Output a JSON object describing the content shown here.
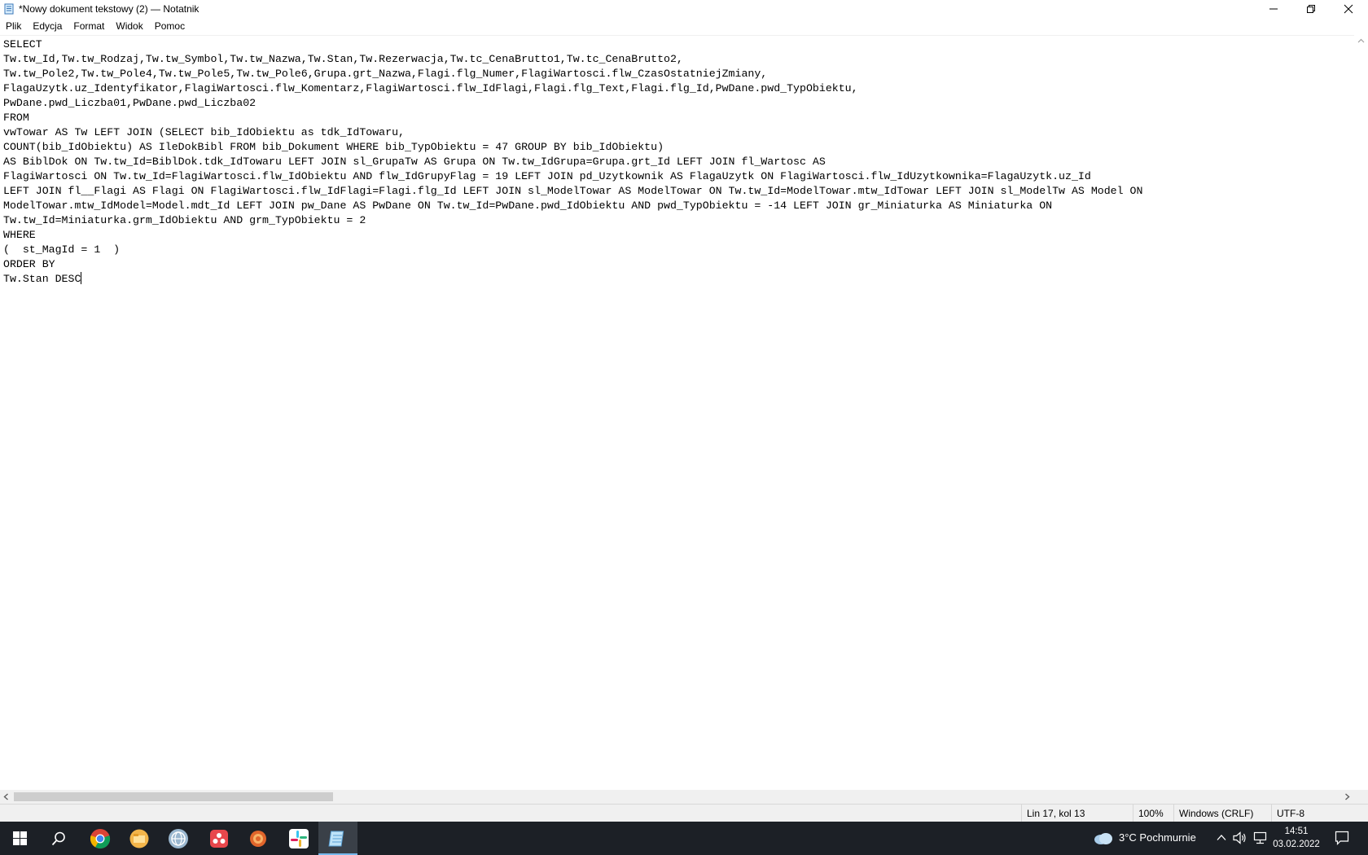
{
  "window": {
    "title": "*Nowy dokument tekstowy (2) — Notatnik"
  },
  "menu": {
    "items": [
      "Plik",
      "Edycja",
      "Format",
      "Widok",
      "Pomoc"
    ]
  },
  "editor": {
    "lines": [
      "SELECT",
      "Tw.tw_Id,Tw.tw_Rodzaj,Tw.tw_Symbol,Tw.tw_Nazwa,Tw.Stan,Tw.Rezerwacja,Tw.tc_CenaBrutto1,Tw.tc_CenaBrutto2,",
      "Tw.tw_Pole2,Tw.tw_Pole4,Tw.tw_Pole5,Tw.tw_Pole6,Grupa.grt_Nazwa,Flagi.flg_Numer,FlagiWartosci.flw_CzasOstatniejZmiany,",
      "FlagaUzytk.uz_Identyfikator,FlagiWartosci.flw_Komentarz,FlagiWartosci.flw_IdFlagi,Flagi.flg_Text,Flagi.flg_Id,PwDane.pwd_TypObiektu,",
      "PwDane.pwd_Liczba01,PwDane.pwd_Liczba02",
      "FROM",
      "vwTowar AS Tw LEFT JOIN (SELECT bib_IdObiektu as tdk_IdTowaru,",
      "COUNT(bib_IdObiektu) AS IleDokBibl FROM bib_Dokument WHERE bib_TypObiektu = 47 GROUP BY bib_IdObiektu)",
      "AS BiblDok ON Tw.tw_Id=BiblDok.tdk_IdTowaru LEFT JOIN sl_GrupaTw AS Grupa ON Tw.tw_IdGrupa=Grupa.grt_Id LEFT JOIN fl_Wartosc AS",
      "FlagiWartosci ON Tw.tw_Id=FlagiWartosci.flw_IdObiektu AND flw_IdGrupyFlag = 19 LEFT JOIN pd_Uzytkownik AS FlagaUzytk ON FlagiWartosci.flw_IdUzytkownika=FlagaUzytk.uz_Id",
      "LEFT JOIN fl__Flagi AS Flagi ON FlagiWartosci.flw_IdFlagi=Flagi.flg_Id LEFT JOIN sl_ModelTowar AS ModelTowar ON Tw.tw_Id=ModelTowar.mtw_IdTowar LEFT JOIN sl_ModelTw AS Model ON",
      "ModelTowar.mtw_IdModel=Model.mdt_Id LEFT JOIN pw_Dane AS PwDane ON Tw.tw_Id=PwDane.pwd_IdObiektu AND pwd_TypObiektu = -14 LEFT JOIN gr_Miniaturka AS Miniaturka ON",
      "Tw.tw_Id=Miniaturka.grm_IdObiektu AND grm_TypObiektu = 2",
      "WHERE",
      "(  st_MagId = 1  )",
      "ORDER BY",
      "Tw.Stan DESC"
    ]
  },
  "status": {
    "position": "Lin 17, kol 13",
    "zoom": "100%",
    "line_ending": "Windows (CRLF)",
    "encoding": "UTF-8"
  },
  "taskbar": {
    "weather": "3°C  Pochmurnie",
    "time": "14:51",
    "date": "03.02.2022"
  }
}
